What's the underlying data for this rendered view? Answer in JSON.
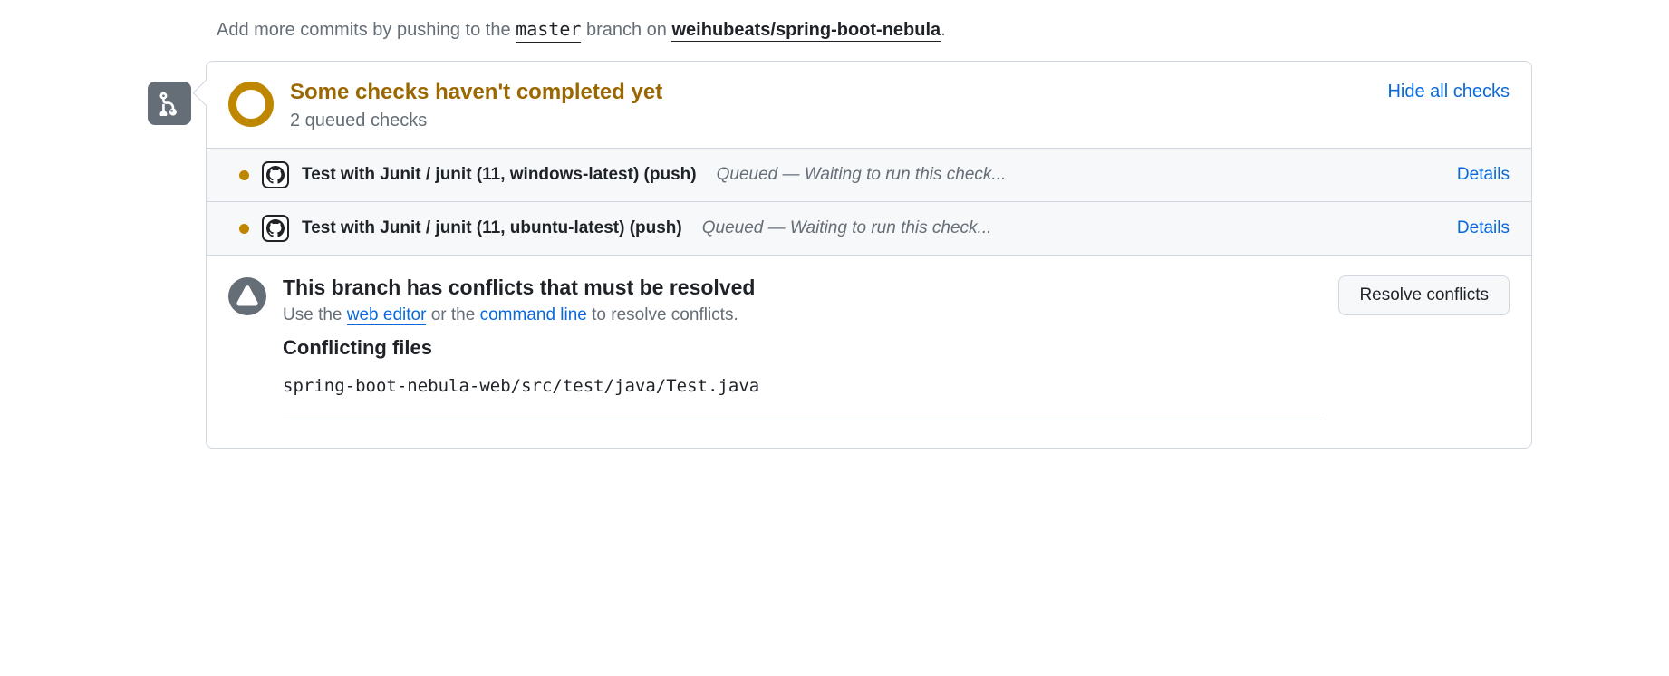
{
  "push_hint": {
    "prefix": "Add more commits by pushing to the ",
    "branch": "master",
    "mid": " branch on ",
    "repo": "weihubeats/spring-boot-nebula",
    "suffix": "."
  },
  "checks_status": {
    "title": "Some checks haven't completed yet",
    "subtitle": "2 queued checks",
    "hide_label": "Hide all checks"
  },
  "checks": [
    {
      "name": "Test with Junit / junit (11, windows-latest) (push)",
      "status": "Queued — Waiting to run this check...",
      "details_label": "Details"
    },
    {
      "name": "Test with Junit / junit (11, ubuntu-latest) (push)",
      "status": "Queued — Waiting to run this check...",
      "details_label": "Details"
    }
  ],
  "conflicts": {
    "title": "This branch has conflicts that must be resolved",
    "hint_prefix": "Use the ",
    "web_editor": "web editor",
    "hint_mid": " or the ",
    "command_line": "command line",
    "hint_suffix": " to resolve conflicts.",
    "files_title": "Conflicting files",
    "files": [
      "spring-boot-nebula-web/src/test/java/Test.java"
    ],
    "resolve_label": "Resolve conflicts"
  }
}
